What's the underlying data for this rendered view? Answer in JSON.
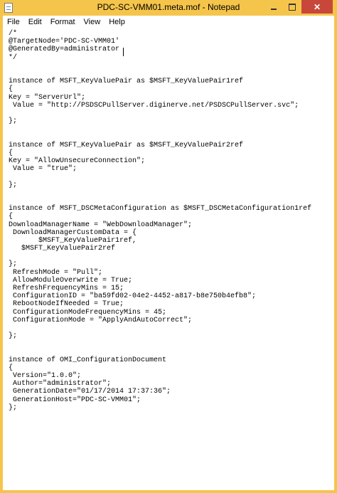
{
  "window": {
    "title": "PDC-SC-VMM01.meta.mof - Notepad",
    "accent_color": "#f5c54b",
    "close_button_color": "#c7473a"
  },
  "menubar": {
    "items": [
      "File",
      "Edit",
      "Format",
      "View",
      "Help"
    ]
  },
  "editor": {
    "lines": [
      "/*",
      "@TargetNode='PDC-SC-VMM01'",
      "@GeneratedBy=administrator",
      "*/",
      "",
      "",
      "instance of MSFT_KeyValuePair as $MSFT_KeyValuePair1ref",
      "{",
      "Key = \"ServerUrl\";",
      " Value = \"http://PSDSCPullServer.diginerve.net/PSDSCPullServer.svc\";",
      "",
      "};",
      "",
      "",
      "instance of MSFT_KeyValuePair as $MSFT_KeyValuePair2ref",
      "{",
      "Key = \"AllowUnsecureConnection\";",
      " Value = \"true\";",
      "",
      "};",
      "",
      "",
      "instance of MSFT_DSCMetaConfiguration as $MSFT_DSCMetaConfiguration1ref",
      "{",
      "DownloadManagerName = \"WebDownloadManager\";",
      " DownloadManagerCustomData = {",
      "       $MSFT_KeyValuePair1ref,",
      "   $MSFT_KeyValuePair2ref",
      "",
      "};",
      " RefreshMode = \"Pull\";",
      " AllowModuleOverwrite = True;",
      " RefreshFrequencyMins = 15;",
      " ConfigurationID = \"ba59fd02-04e2-4452-a817-b8e750b4efb8\";",
      " RebootNodeIfNeeded = True;",
      " ConfigurationModeFrequencyMins = 45;",
      " ConfigurationMode = \"ApplyAndAutoCorrect\";",
      "",
      "};",
      "",
      "",
      "instance of OMI_ConfigurationDocument",
      "{",
      " Version=\"1.0.0\";",
      " Author=\"administrator\";",
      " GenerationDate=\"01/17/2014 17:37:36\";",
      " GenerationHost=\"PDC-SC-VMM01\";",
      "};"
    ]
  }
}
